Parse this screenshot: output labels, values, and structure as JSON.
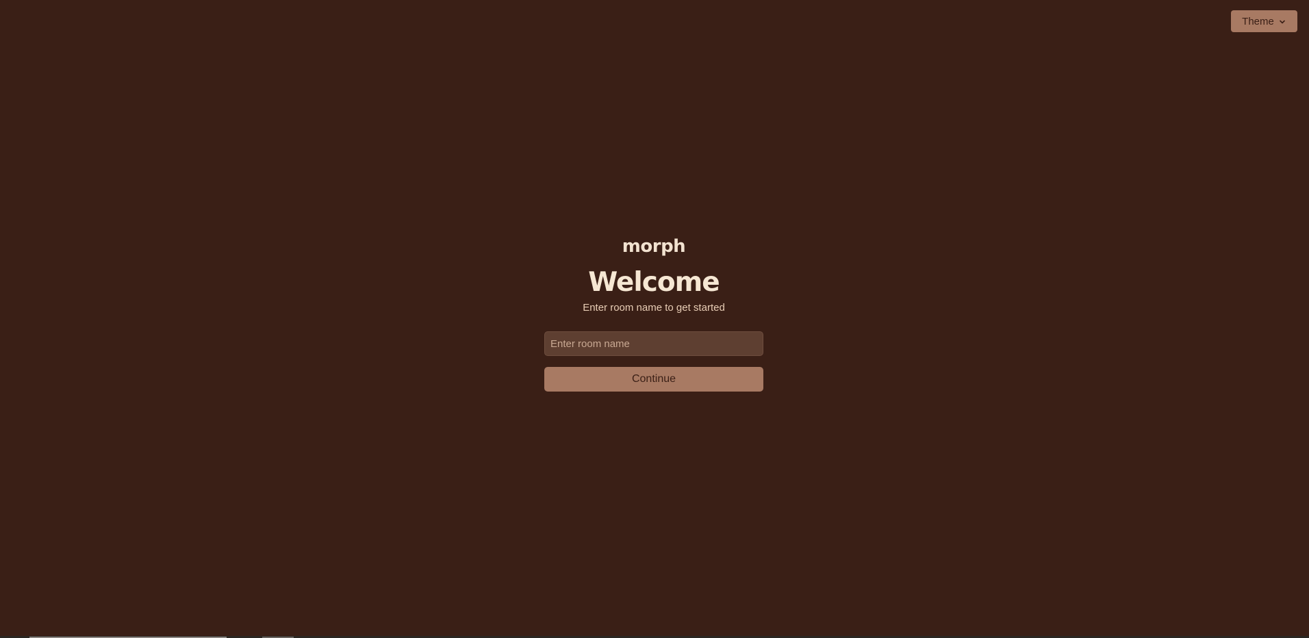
{
  "header": {
    "theme_label": "Theme",
    "theme_icon": "chevron-down-icon"
  },
  "main": {
    "logo_text": "morph",
    "title": "Welcome",
    "subtitle": "Enter room name to get started",
    "room_input": {
      "value": "",
      "placeholder": "Enter room name"
    },
    "continue_label": "Continue"
  },
  "colors": {
    "background": "#3a1f16",
    "accent": "#a87a63",
    "input_background": "#5e3f31",
    "text_primary": "#f6e7d3"
  }
}
